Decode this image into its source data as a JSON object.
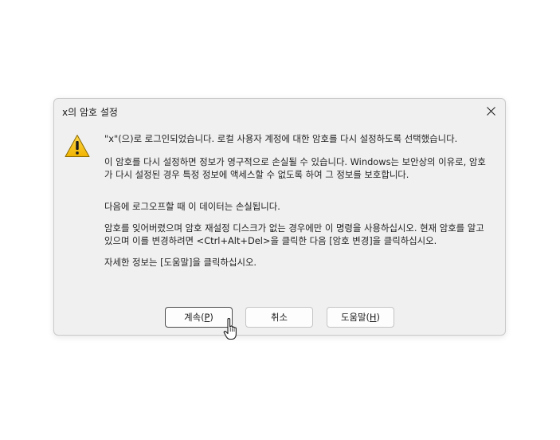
{
  "dialog": {
    "title": "x의 암호 설정",
    "close_icon": "close-icon",
    "warning_icon": "warning-icon",
    "paragraphs": [
      "\"x\"(으)로 로그인되었습니다. 로컬 사용자 계정에 대한 암호를 다시 설정하도록 선택했습니다.",
      "이 암호를 다시 설정하면 정보가 영구적으로 손실될 수 있습니다. Windows는 보안상의 이유로, 암호가 다시 설정된 경우 특정 정보에 액세스할 수 없도록 하여 그 정보를 보호합니다.",
      "다음에 로그오프할 때 이 데이터는 손실됩니다.",
      "암호를 잊어버렸으며 암호 재설정 디스크가 없는 경우에만 이 명령을 사용하십시오. 현재 암호를 알고 있으며 이를 변경하려면 <Ctrl+Alt+Del>을 클릭한 다음 [암호 변경]을 클릭하십시오.",
      "자세한 정보는 [도움말]을 클릭하십시오."
    ],
    "buttons": {
      "continue_label": "계속(",
      "continue_key": "P",
      "continue_end": ")",
      "cancel_label": "취소",
      "help_label": "도움말(",
      "help_key": "H",
      "help_end": ")"
    }
  },
  "colors": {
    "dialog_bg": "#f0f0f0",
    "warning_yellow": "#f5c400",
    "default_button_border": "#4a4a4a"
  }
}
